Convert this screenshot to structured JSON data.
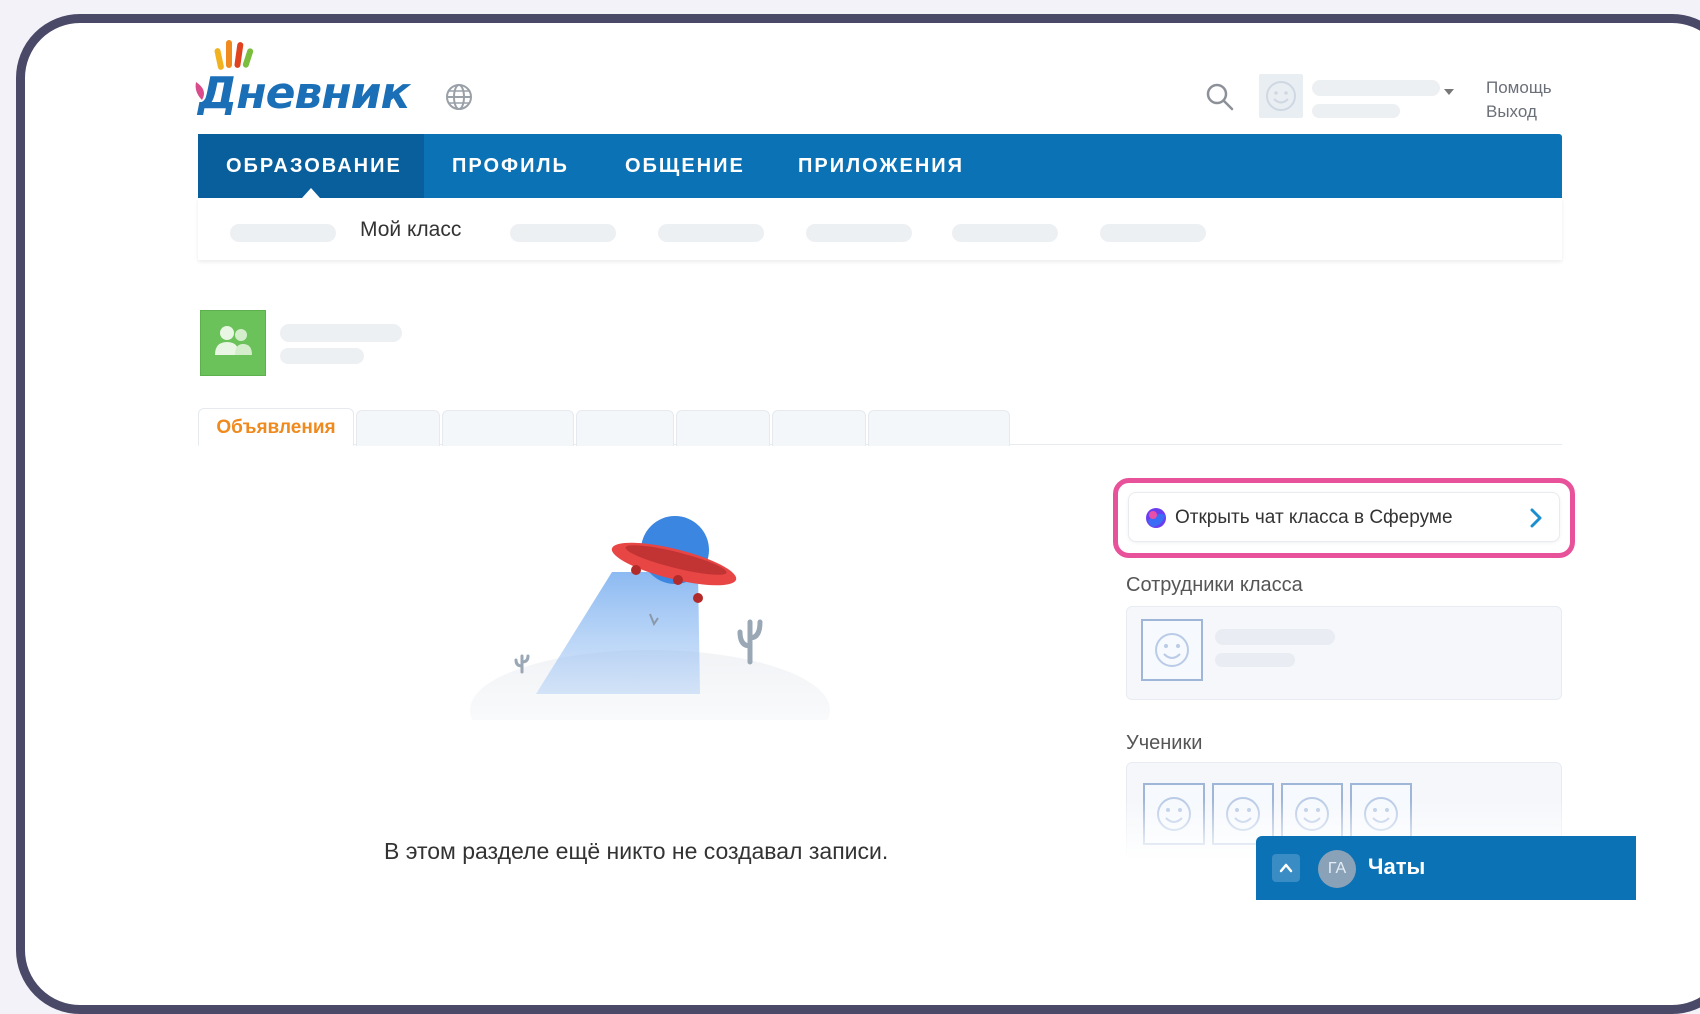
{
  "header": {
    "logo_text": "Дневник",
    "help_link": "Помощь",
    "logout_link": "Выход"
  },
  "nav": {
    "items": [
      {
        "label": "ОБРАЗОВАНИЕ"
      },
      {
        "label": "ПРОФИЛЬ"
      },
      {
        "label": "ОБЩЕНИЕ"
      },
      {
        "label": "ПРИЛОЖЕНИЯ"
      }
    ]
  },
  "subnav": {
    "my_class": "Мой класс"
  },
  "tabs": {
    "active": "Объявления"
  },
  "main": {
    "empty_message": "В этом разделе ещё никто не создавал записи."
  },
  "sidebar": {
    "sferum_button": "Открыть чат класса в Сферуме",
    "staff_title": "Сотрудники класса",
    "students_title": "Ученики"
  },
  "chats": {
    "avatar_initials": "ГА",
    "label": "Чаты"
  },
  "colors": {
    "brand_blue": "#0b72b5",
    "highlight_pink": "#e8529b",
    "tab_active_orange": "#ef8a1e"
  }
}
